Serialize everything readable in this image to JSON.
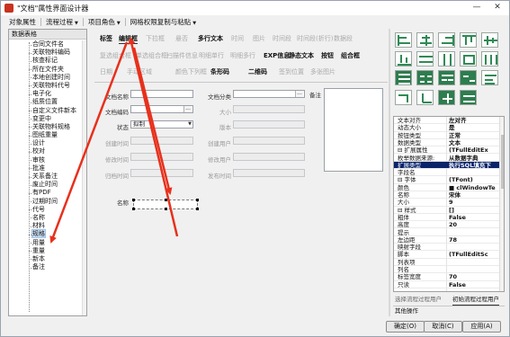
{
  "window": {
    "title": "\"文档\"属性界面设计器",
    "minimize_glyph": "—",
    "close_glyph": "✕"
  },
  "menubar": {
    "items": [
      {
        "label": "对象属性"
      },
      {
        "label": "流程过程",
        "arrow": "▼"
      },
      {
        "label": "项目角色",
        "arrow": "▼"
      },
      {
        "label": "网格权限复制与粘贴",
        "arrow": "▼"
      }
    ]
  },
  "tree": {
    "header": "数据表格",
    "selected_index": 23,
    "items": [
      "合同文件名",
      "关联物料编码",
      "核查标记",
      "所在文件夹",
      "本地创建时间",
      "关联物料代号",
      "电子化",
      "纸质位置",
      "自定义文件新本",
      "变更中",
      "关联物料规格",
      "图纸重量",
      "设计",
      "校对",
      "审核",
      "批准",
      "关系备注",
      "废止时间",
      "有PDF",
      "过期时间",
      "代号",
      "名称",
      "材料",
      "规格",
      "用量",
      "重量",
      "新本",
      "备注"
    ]
  },
  "toolbar": {
    "row1": [
      "标签",
      "编辑框",
      "下拉框",
      "悬否",
      "多行文本",
      "时间",
      "图片",
      "时间段",
      "时间段(折行)",
      "数据段"
    ],
    "row1_active": [
      0,
      1,
      4
    ],
    "row2": [
      "复选组合框",
      "单选组合框",
      "扫描件信息",
      "明细单行",
      "明细多行",
      "EXP信息",
      "静态文本",
      "按钮",
      "组合框"
    ],
    "row2_active": [
      5,
      6,
      7,
      8
    ],
    "row3": [
      "日期",
      "",
      "",
      "",
      "",
      ""
    ],
    "row3_labels": [
      "日期",
      "手动区域",
      "颜色下列框",
      "条形码",
      "二维码",
      "签到位置",
      "多张图片"
    ],
    "row3_active": [
      3,
      4
    ]
  },
  "form": {
    "doc_name_label": "文档名称",
    "doc_category_label": "文档分类",
    "remark_label": "备注",
    "doc_code_label": "文档编码",
    "size_label": "大小",
    "status_label": "状态",
    "status_value": "拟制",
    "version_label": "版本",
    "created_time_label": "创建时间",
    "created_user_label": "创建用户",
    "modified_time_label": "修改时间",
    "modified_user_label": "修改用户",
    "archived_time_label": "归档时间",
    "published_time_label": "发布时间",
    "name_widget_label": "名称",
    "dots_glyph": "...",
    "dropdown_glyph": "▼"
  },
  "properties": {
    "rows": [
      {
        "key": "文本对齐",
        "value": "左对齐"
      },
      {
        "key": "动态大小",
        "value": "是"
      },
      {
        "key": "按钮类型",
        "value": "正常"
      },
      {
        "key": "数据类型",
        "value": "文本"
      },
      {
        "key": "⊟ 扩展属性",
        "value": "(TFullEditEx"
      },
      {
        "key": "  枚举数据来源:",
        "value": "从数据字典"
      },
      {
        "key": "  扩展类型",
        "value": "执行SQL填充下"
      },
      {
        "key": "字段名",
        "value": ""
      },
      {
        "key": "⊟ 字体",
        "value": "(TFont)"
      },
      {
        "key": "  颜色",
        "value": "■ clWindowTe"
      },
      {
        "key": "  名称",
        "value": "宋体"
      },
      {
        "key": "  大小",
        "value": "9"
      },
      {
        "key": "  ⊟ 样式",
        "value": "[]"
      },
      {
        "key": "      粗体",
        "value": "False"
      },
      {
        "key": "高度",
        "value": "20"
      },
      {
        "key": "提示",
        "value": ""
      },
      {
        "key": "左边距",
        "value": "78"
      },
      {
        "key": "映射字段",
        "value": ""
      },
      {
        "key": "脚本",
        "value": "(TFullEditSc"
      },
      {
        "key": "列表项",
        "value": ""
      },
      {
        "key": "列名",
        "value": ""
      },
      {
        "key": "标签宽度",
        "value": "70"
      },
      {
        "key": "只读",
        "value": "False"
      }
    ],
    "selected_row": 6,
    "tabs": [
      "选择流程过程用户",
      "初始流程过程用户"
    ],
    "footer": "其他操作"
  },
  "buttons": {
    "ok": "确定(O)",
    "cancel": "取消(C)",
    "apply": "应用(A)"
  },
  "colors": {
    "annotation_arrow": "#e8301c",
    "palette_green": "#2f8a55",
    "selected_row": "#0a246a"
  }
}
